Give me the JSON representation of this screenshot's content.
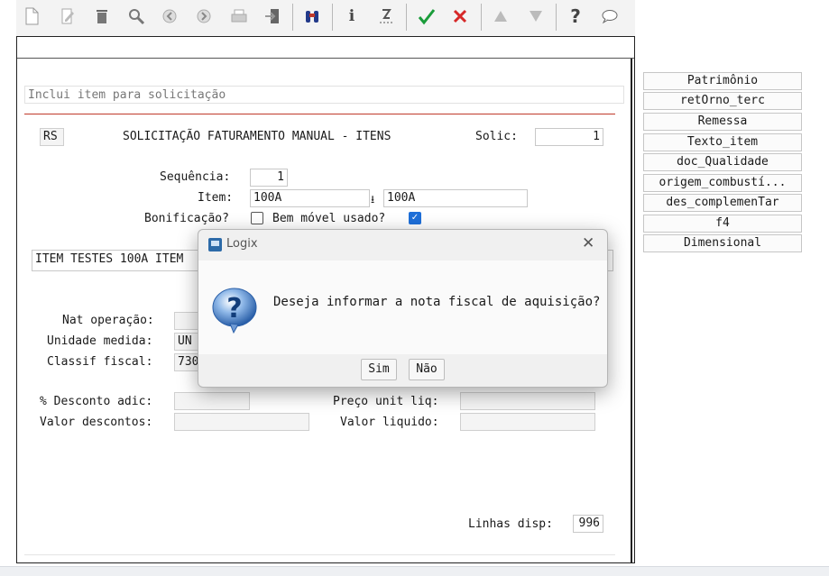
{
  "toolbar": {
    "icons": [
      "new-document-icon",
      "edit-icon",
      "delete-trash-icon",
      "search-icon",
      "previous-icon",
      "next-icon",
      "print-icon",
      "exit-icon",
      "binoculars-icon",
      "info-icon",
      "sort-icon",
      "confirm-check-icon",
      "cancel-x-icon",
      "first-record-icon",
      "last-record-icon",
      "help-icon",
      "comment-icon"
    ]
  },
  "form": {
    "hint_placeholder": "Inclui item para solicitação",
    "state_code": "RS",
    "title": "SOLICITAÇÃO FATURAMENTO MANUAL - ITENS",
    "solic_label": "Solic:",
    "solic_value": "1",
    "sequencia_label": "Sequência:",
    "sequencia_value": "1",
    "item_label": "Item:",
    "item_code": "100A",
    "item_code_2": "100A",
    "bonificacao_label": "Bonificação?",
    "bem_movel_label": "Bem móvel usado?",
    "bonificacao_checked": false,
    "bem_movel_checked": true,
    "item_description": "ITEM TESTES 100A ITEM",
    "nat_operacao_label": "Nat operação:",
    "unidade_label": "Unidade medida:",
    "unidade_value": "UN",
    "classif_label": "Classif fiscal:",
    "classif_value": "730",
    "desconto_label": "% Desconto adic:",
    "valor_descontos_label": "Valor descontos:",
    "preco_label": "Preço unit liq:",
    "valor_liquido_label": "Valor liquido:",
    "linhas_label": "Linhas disp:",
    "linhas_value": "996"
  },
  "side_buttons": [
    "Patrimônio",
    "retOrno_terc",
    "Remessa",
    "Texto_item",
    "doc_Qualidade",
    "origem_combustí...",
    "des_complemenTar",
    "f4",
    "Dimensional"
  ],
  "dialog": {
    "title": "Logix",
    "message": "Deseja informar a nota fiscal de aquisição?",
    "yes_label": "Sim",
    "no_label": "Não"
  },
  "colors": {
    "accent": "#1e6fd9",
    "redline": "#c0392b",
    "green_check": "#1a9c3a",
    "red_x": "#d62828"
  }
}
